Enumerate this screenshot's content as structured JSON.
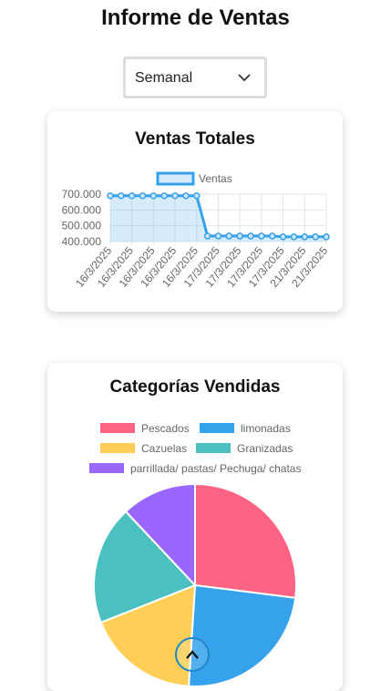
{
  "page": {
    "title": "Informe de Ventas"
  },
  "filter": {
    "selected": "Semanal",
    "icon": "chevron-down-icon"
  },
  "sales_card": {
    "title": "Ventas Totales"
  },
  "categories_card": {
    "title": "Categorías Vendidas"
  },
  "scroll_top": {
    "icon": "chevron-up-icon"
  },
  "chart_data": [
    {
      "type": "area",
      "title": "",
      "legend": [
        "Ventas"
      ],
      "legend_position": "top",
      "x": [
        "16/3/2025",
        "16/3/2025",
        "16/3/2025",
        "16/3/2025",
        "16/3/2025",
        "16/3/2025",
        "16/3/2025",
        "16/3/2025",
        "16/3/2025",
        "17/3/2025",
        "17/3/2025",
        "17/3/2025",
        "17/3/2025",
        "17/3/2025",
        "17/3/2025",
        "17/3/2025",
        "21/3/2025",
        "21/3/2025",
        "21/3/2025",
        "21/3/2025",
        "21/3/2025"
      ],
      "x_tick_labels": [
        "16/3/2025",
        "16/3/2025",
        "16/3/2025",
        "16/3/2025",
        "16/3/2025",
        "17/3/2025",
        "17/3/2025",
        "17/3/2025",
        "17/3/2025",
        "21/3/2025",
        "21/3/2025"
      ],
      "series": [
        {
          "name": "Ventas",
          "values": [
            690000,
            690000,
            690000,
            690000,
            690000,
            690000,
            690000,
            690000,
            690000,
            435000,
            435000,
            435000,
            435000,
            435000,
            435000,
            435000,
            430000,
            430000,
            430000,
            430000,
            430000
          ]
        }
      ],
      "y_ticks": [
        "700.000",
        "600.000",
        "500.000",
        "400.000"
      ],
      "ylim": [
        400000,
        700000
      ],
      "grid": true,
      "colors": {
        "line": "#36a2eb",
        "fill": "rgba(54,162,235,0.2)"
      }
    },
    {
      "type": "pie",
      "title": "",
      "legend_position": "top",
      "slices": [
        {
          "label": "Pescados",
          "value": 27,
          "color": "#ff6384"
        },
        {
          "label": "limonadas",
          "value": 24,
          "color": "#36a2eb"
        },
        {
          "label": "Cazuelas",
          "value": 18,
          "color": "#ffce56"
        },
        {
          "label": "Granizadas",
          "value": 19,
          "color": "#4bc0c0"
        },
        {
          "label": "parrillada/ pastas/ Pechuga/ chatas",
          "value": 12,
          "color": "#9966ff"
        }
      ]
    }
  ]
}
